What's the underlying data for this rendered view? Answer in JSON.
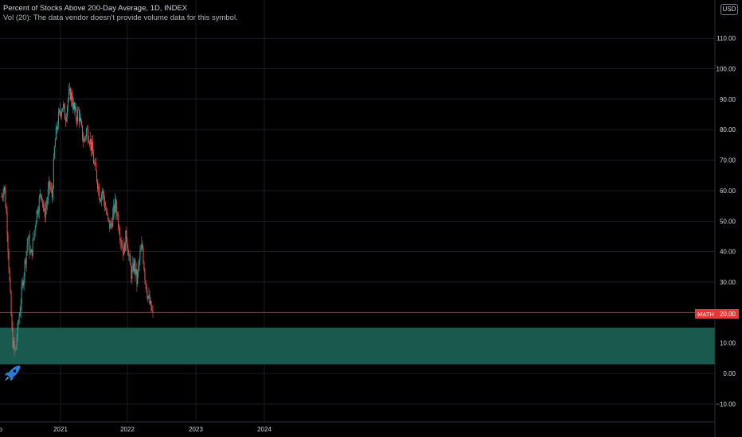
{
  "header": {
    "title": "Percent of Stocks Above 200-Day Average, 1D, INDEX",
    "volume_note": "Vol (20): The data vendor doesn't provide volume data for this symbol."
  },
  "currency_badge": "USD",
  "price_tag": {
    "label": "MATH",
    "value": "20.00"
  },
  "colors": {
    "background": "#000000",
    "grid": "#2a2e39",
    "up": "#26a69a",
    "down": "#ef5350",
    "zone": "#1a5a4e",
    "price_line": "#e53935"
  },
  "icons": {
    "rocket": "rocket-icon"
  },
  "chart_data": {
    "type": "candlestick",
    "title": "Percent of Stocks Above 200-Day Average, 1D, INDEX",
    "ylim": [
      -13,
      125
    ],
    "y_ticks": [
      "−10.00",
      "0.00",
      "10.00",
      "20.00",
      "30.00",
      "40.00",
      "50.00",
      "60.00",
      "70.00",
      "80.00",
      "90.00",
      "100.00",
      "110.00"
    ],
    "x_ticks": [
      "Feb",
      "2021",
      "2022",
      "2023",
      "2024"
    ],
    "current_value": 20.0,
    "zone": [
      3,
      15
    ],
    "series": [
      {
        "date": "2020-02",
        "close": 58
      },
      {
        "date": "2020-02",
        "close": 62
      },
      {
        "date": "2020-03",
        "close": 50
      },
      {
        "date": "2020-03",
        "close": 30
      },
      {
        "date": "2020-03",
        "close": 12
      },
      {
        "date": "2020-03",
        "close": 6
      },
      {
        "date": "2020-04",
        "close": 14
      },
      {
        "date": "2020-04",
        "close": 22
      },
      {
        "date": "2020-05",
        "close": 30
      },
      {
        "date": "2020-05",
        "close": 38
      },
      {
        "date": "2020-06",
        "close": 45
      },
      {
        "date": "2020-06",
        "close": 38
      },
      {
        "date": "2020-07",
        "close": 44
      },
      {
        "date": "2020-07",
        "close": 52
      },
      {
        "date": "2020-08",
        "close": 56
      },
      {
        "date": "2020-08",
        "close": 60
      },
      {
        "date": "2020-09",
        "close": 52
      },
      {
        "date": "2020-09",
        "close": 56
      },
      {
        "date": "2020-10",
        "close": 62
      },
      {
        "date": "2020-10",
        "close": 58
      },
      {
        "date": "2020-11",
        "close": 75
      },
      {
        "date": "2020-11",
        "close": 82
      },
      {
        "date": "2020-12",
        "close": 86
      },
      {
        "date": "2020-12",
        "close": 88
      },
      {
        "date": "2021-01",
        "close": 84
      },
      {
        "date": "2021-01",
        "close": 90
      },
      {
        "date": "2021-02",
        "close": 92
      },
      {
        "date": "2021-02",
        "close": 88
      },
      {
        "date": "2021-03",
        "close": 84
      },
      {
        "date": "2021-03",
        "close": 86
      },
      {
        "date": "2021-04",
        "close": 80
      },
      {
        "date": "2021-04",
        "close": 76
      },
      {
        "date": "2021-05",
        "close": 80
      },
      {
        "date": "2021-05",
        "close": 78
      },
      {
        "date": "2021-06",
        "close": 74
      },
      {
        "date": "2021-06",
        "close": 68
      },
      {
        "date": "2021-07",
        "close": 64
      },
      {
        "date": "2021-07",
        "close": 58
      },
      {
        "date": "2021-08",
        "close": 60
      },
      {
        "date": "2021-08",
        "close": 55
      },
      {
        "date": "2021-09",
        "close": 50
      },
      {
        "date": "2021-09",
        "close": 48
      },
      {
        "date": "2021-10",
        "close": 52
      },
      {
        "date": "2021-10",
        "close": 56
      },
      {
        "date": "2021-11",
        "close": 50
      },
      {
        "date": "2021-11",
        "close": 44
      },
      {
        "date": "2021-12",
        "close": 40
      },
      {
        "date": "2021-12",
        "close": 46
      },
      {
        "date": "2022-01",
        "close": 38
      },
      {
        "date": "2022-01",
        "close": 32
      },
      {
        "date": "2022-02",
        "close": 36
      },
      {
        "date": "2022-02",
        "close": 30
      },
      {
        "date": "2022-03",
        "close": 38
      },
      {
        "date": "2022-03",
        "close": 42
      },
      {
        "date": "2022-04",
        "close": 32
      },
      {
        "date": "2022-04",
        "close": 26
      },
      {
        "date": "2022-05",
        "close": 22
      },
      {
        "date": "2022-05",
        "close": 19
      }
    ]
  }
}
